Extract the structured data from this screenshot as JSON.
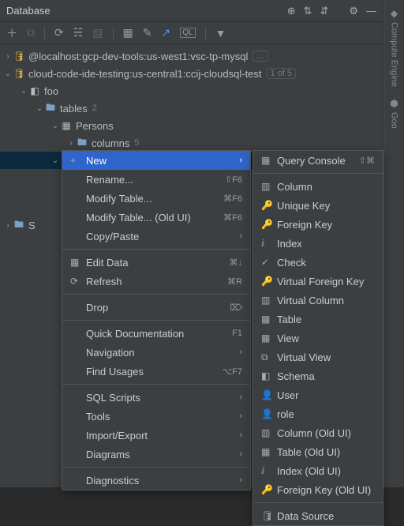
{
  "title": "Database",
  "sidebar_labels": {
    "ce": "Compute Engine",
    "goo": "Goo"
  },
  "tree": {
    "ds1": "@localhost:gcp-dev-tools:us-west1:vsc-tp-mysql",
    "ds1_badge": "...",
    "ds2": "cloud-code-ide-testing:us-central1:ccij-cloudsql-test",
    "ds2_badge": "1 of 5",
    "schema": "foo",
    "tables": "tables",
    "tables_count": "2",
    "table1": "Persons",
    "columns": "columns",
    "columns_count": "5",
    "bottom": "S"
  },
  "context_menu": [
    {
      "icon": "+",
      "label": "New",
      "tail": "›",
      "hi": true
    },
    {
      "label": "Rename...",
      "tail": "⇧F6"
    },
    {
      "label": "Modify Table...",
      "tail": "⌘F6"
    },
    {
      "label": "Modify Table... (Old UI)",
      "tail": "⌘F6"
    },
    {
      "label": "Copy/Paste",
      "tail": "›"
    },
    {
      "sep": true
    },
    {
      "icon": "▦",
      "label": "Edit Data",
      "tail": "⌘↓"
    },
    {
      "icon": "⟳",
      "label": "Refresh",
      "tail": "⌘R"
    },
    {
      "sep": true
    },
    {
      "label": "Drop",
      "tail": "⌦"
    },
    {
      "sep": true
    },
    {
      "label": "Quick Documentation",
      "tail": "F1"
    },
    {
      "label": "Navigation",
      "tail": "›"
    },
    {
      "label": "Find Usages",
      "tail": "⌥F7"
    },
    {
      "sep": true
    },
    {
      "label": "SQL Scripts",
      "tail": "›"
    },
    {
      "label": "Tools",
      "tail": "›"
    },
    {
      "label": "Import/Export",
      "tail": "›"
    },
    {
      "label": "Diagrams",
      "tail": "›"
    },
    {
      "sep": true
    },
    {
      "label": "Diagnostics",
      "tail": "›"
    }
  ],
  "submenu_header": {
    "icon": "▦",
    "label": "Query Console",
    "tail": "⇧⌘"
  },
  "submenu": [
    {
      "icon": "▥",
      "label": "Column"
    },
    {
      "icon": "🔑",
      "cls": "key-icon",
      "label": "Unique Key"
    },
    {
      "icon": "🔑",
      "cls": "key-fk",
      "label": "Foreign Key"
    },
    {
      "icon": "ⅈ",
      "label": "Index"
    },
    {
      "icon": "✓",
      "label": "Check"
    },
    {
      "icon": "🔑",
      "cls": "key-fk",
      "label": "Virtual Foreign Key"
    },
    {
      "icon": "▥",
      "label": "Virtual Column"
    },
    {
      "icon": "▦",
      "label": "Table"
    },
    {
      "icon": "▦",
      "label": "View"
    },
    {
      "icon": "⧉",
      "label": "Virtual View"
    },
    {
      "icon": "◧",
      "label": "Schema"
    },
    {
      "icon": "👤",
      "label": "User"
    },
    {
      "icon": "👤",
      "label": "role"
    },
    {
      "icon": "▥",
      "label": "Column (Old UI)"
    },
    {
      "icon": "▦",
      "label": "Table (Old UI)"
    },
    {
      "icon": "ⅈ",
      "label": "Index (Old UI)"
    },
    {
      "icon": "🔑",
      "cls": "key-fk",
      "label": "Foreign Key (Old UI)"
    },
    {
      "sep": true
    },
    {
      "icon": "🛢",
      "label": "Data Source"
    }
  ]
}
